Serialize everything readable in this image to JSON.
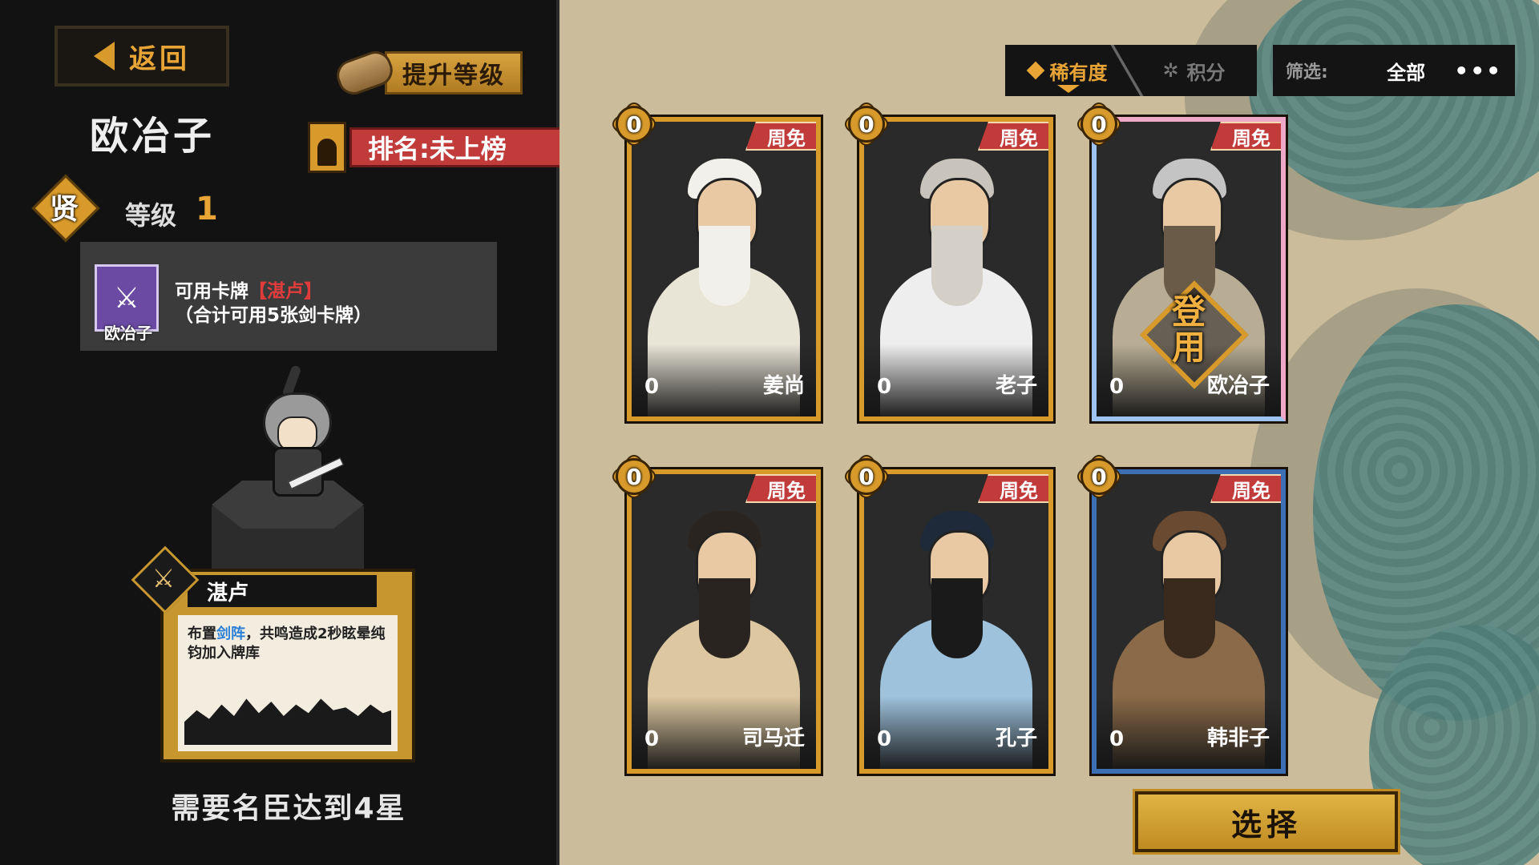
{
  "left_panel": {
    "back_label": "返回",
    "upgrade_label": "提升等级",
    "hero_name": "欧冶子",
    "rank_label": "排名:未上榜",
    "tier_label": "贤",
    "level_label": "等级",
    "level_value": "1",
    "card_info": {
      "icon_caption": "欧冶子",
      "line1_prefix": "可用卡牌",
      "line1_highlight": "【湛卢】",
      "line2": "（合计可用5张剑卡牌）"
    },
    "skill_card": {
      "title": "湛卢",
      "desc_prefix": "布置",
      "desc_highlight": "剑阵",
      "desc_suffix": "，共鸣造成2秒眩晕纯钧加入牌库"
    },
    "requirement": "需要名臣达到4星"
  },
  "sort_tabs": [
    {
      "label": "稀有度",
      "icon": "diamond-icon",
      "active": true
    },
    {
      "label": "积分",
      "icon": "flower-icon",
      "active": false
    }
  ],
  "filter": {
    "label": "筛选:",
    "value": "全部",
    "more": "•••"
  },
  "cards": [
    {
      "name": "姜尚",
      "count": "0",
      "stars": "0",
      "tag": "周免",
      "frame": "gold",
      "in_use": false,
      "robe_color": "#e8e4d6",
      "hair_color": "#f2f0ea",
      "beard_color": "#f2f0ea"
    },
    {
      "name": "老子",
      "count": "0",
      "stars": "0",
      "tag": "周免",
      "frame": "gold",
      "in_use": false,
      "robe_color": "#eeeeee",
      "hair_color": "#c8c4bc",
      "beard_color": "#d4d0c8"
    },
    {
      "name": "欧冶子",
      "count": "0",
      "stars": "0",
      "tag": "周免",
      "frame": "pink",
      "in_use": true,
      "in_use_label_1": "登",
      "in_use_label_2": "用",
      "robe_color": "#b8ad94",
      "hair_color": "#c4c4c4",
      "beard_color": "#6a5a48"
    },
    {
      "name": "司马迁",
      "count": "0",
      "stars": "0",
      "tag": "周免",
      "frame": "gold",
      "in_use": false,
      "robe_color": "#dcc7a0",
      "hair_color": "#2a2420",
      "beard_color": "#2a2420"
    },
    {
      "name": "孔子",
      "count": "0",
      "stars": "0",
      "tag": "周免",
      "frame": "gold",
      "in_use": false,
      "robe_color": "#9ec2dc",
      "hair_color": "#1e2a3a",
      "beard_color": "#1a1a1a"
    },
    {
      "name": "韩非子",
      "count": "0",
      "stars": "0",
      "tag": "周免",
      "frame": "blue",
      "in_use": false,
      "robe_color": "#8a6a48",
      "hair_color": "#6a4a30",
      "beard_color": "#3a2a1e"
    }
  ],
  "select_label": "选择",
  "colors": {
    "accent": "#e8a536",
    "rank_red": "#c23b3b",
    "highlight_red": "#e03c3c",
    "highlight_blue": "#2b7fd6"
  }
}
